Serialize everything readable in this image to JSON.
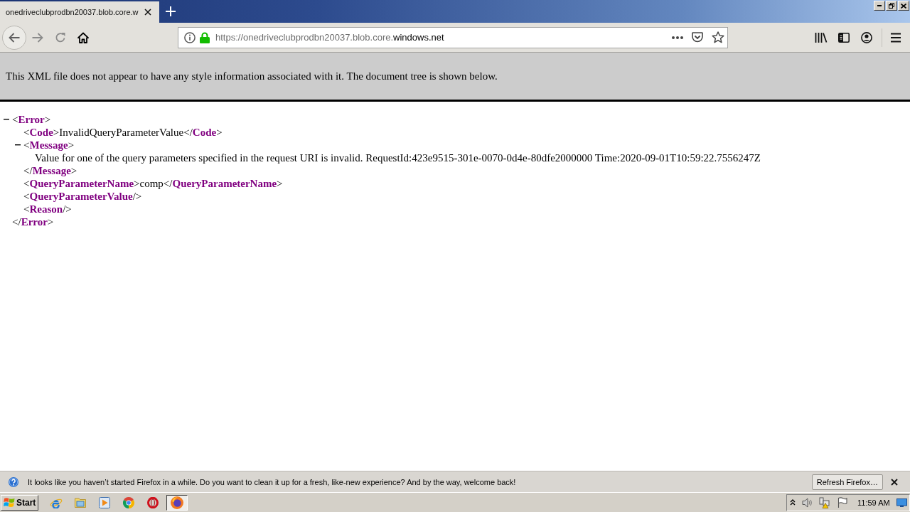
{
  "tabs": [
    {
      "title": "onedriveclubprodbn20037.blob.core.w",
      "selected": true
    }
  ],
  "address_bar": {
    "url_start": "https://onedriveclubprodbn20037.blob.core.",
    "url_end": "windows.net"
  },
  "xml_viewer": {
    "notice": "This XML file does not appear to have any style information associated with it. The document tree is shown below.",
    "tree": {
      "open": "<**Error**>",
      "expanded": true,
      "children": [
        {
          "line": "<**Code**>InvalidQueryParameterValue</**Code**>"
        },
        {
          "open": "<**Message**>",
          "expanded": true,
          "children": [
            {
              "line": "Value for one of the query parameters specified in the request URI is invalid. RequestId:423e9515-301e-0070-0d4e-80dfe2000000 Time:2020-09-01T10:59:22.7556247Z"
            }
          ],
          "close": "</**Message**>"
        },
        {
          "line": "<**QueryParameterName**>comp</**QueryParameterName**>"
        },
        {
          "line": "<**QueryParameterValue**/>"
        },
        {
          "line": "<**Reason**/>"
        }
      ],
      "close": "</**Error**>"
    }
  },
  "notification": {
    "message": "It looks like you haven’t started Firefox in a while. Do you want to clean it up for a fresh, like-new experience? And by the way, welcome back!",
    "button": "Refresh Firefox…"
  },
  "taskbar": {
    "start": "Start",
    "items": [
      {
        "kind": "e_logo",
        "selected": false
      },
      {
        "kind": "folder",
        "selected": false
      },
      {
        "kind": "play",
        "selected": false
      },
      {
        "kind": "segmented",
        "selected": false
      },
      {
        "kind": "ring",
        "selected": false
      },
      {
        "kind": "orb",
        "selected": true
      }
    ],
    "clock": "11:59 AM"
  }
}
